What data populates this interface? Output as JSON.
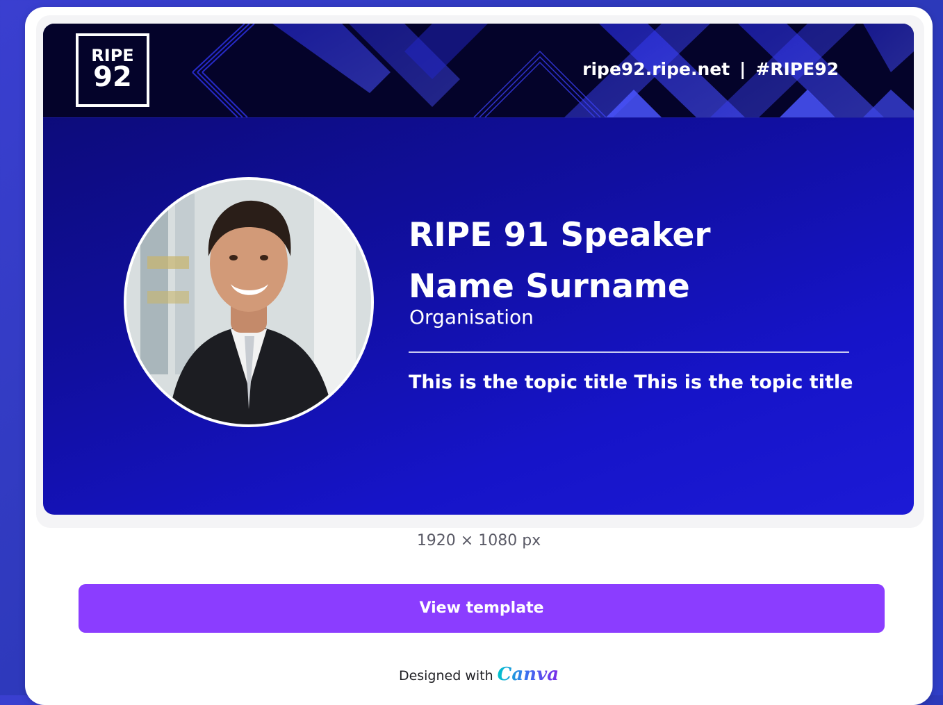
{
  "template": {
    "logo": {
      "line1": "RIPE",
      "line2": "92"
    },
    "banner": {
      "website": "ripe92.ripe.net",
      "separator": "|",
      "hashtag": "#RIPE92"
    },
    "speaker": {
      "title_line1": "RIPE 91 Speaker",
      "title_line2": "Name Surname",
      "organisation": "Organisation",
      "topic": "This is the topic title This is the topic title"
    },
    "photo_icon": "speaker-photo-icon"
  },
  "dimensions": "1920 × 1080 px",
  "view_button": {
    "label": "View template"
  },
  "footer": {
    "designed_with": "Designed with",
    "brand": "Canva"
  },
  "colors": {
    "button": "#8b3dff",
    "banner": "#04032a",
    "template_bg": "#1614c8",
    "page_bg": "#2c38b8"
  }
}
